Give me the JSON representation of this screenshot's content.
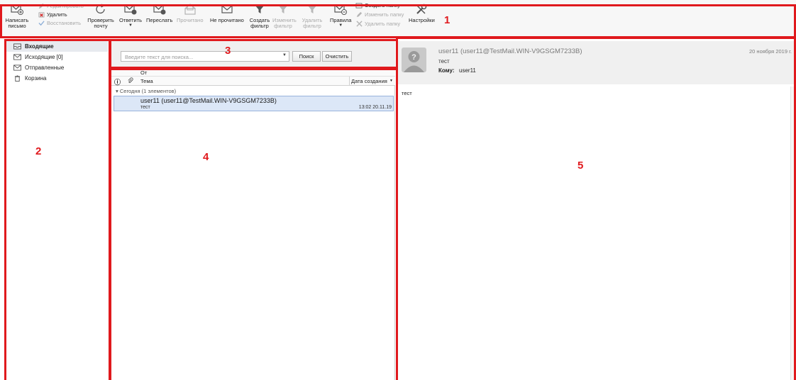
{
  "toolbar": {
    "compose": "Написать письмо",
    "edit": "Редактировать",
    "delete": "Удалить",
    "restore": "Восстановить",
    "check_mail": "Проверить почту",
    "reply": "Ответить",
    "forward": "Переслать",
    "mark_read": "Прочитано",
    "mark_unread": "Не прочитано",
    "create_filter": "Создать фильтр",
    "edit_filter": "Изменить фильтр",
    "delete_filter": "Удалить фильтр",
    "rules": "Правила",
    "create_folder": "Создать папку",
    "rename_folder": "Изменить папку",
    "delete_folder": "Удалить папку",
    "settings": "Настройки"
  },
  "annotations": {
    "a1": "1",
    "a2": "2",
    "a3": "3",
    "a4": "4",
    "a5": "5"
  },
  "folders": [
    {
      "label": "Входящие",
      "icon": "inbox-icon",
      "selected": true
    },
    {
      "label": "Исходящие [0]",
      "icon": "outbox-icon",
      "selected": false
    },
    {
      "label": "Отправленные",
      "icon": "sent-icon",
      "selected": false
    },
    {
      "label": "Корзина",
      "icon": "trash-icon",
      "selected": false
    }
  ],
  "search": {
    "placeholder": "Введите текст для поиска...",
    "search_button": "Поиск",
    "clear_button": "Очистить"
  },
  "list": {
    "col_from": "От",
    "col_subject": "Тема",
    "col_date": "Дата создания",
    "group": "Сегодня (1 элементов)",
    "messages": [
      {
        "from": "user11 (user11@TestMail.WIN-V9GSGM7233B)",
        "subject": "тест",
        "date": "13:02 20.11.19"
      }
    ]
  },
  "preview": {
    "from": "user11 (user11@TestMail.WIN-V9GSGM7233B)",
    "subject": "тест",
    "to_label": "Кому:",
    "to_value": "user11",
    "date": "20 ноября 2019 г.",
    "body": "тест"
  },
  "colors": {
    "annotation": "#e0191d",
    "selection": "#dce7f7",
    "toolbar_bg": "#f7f7f7"
  }
}
